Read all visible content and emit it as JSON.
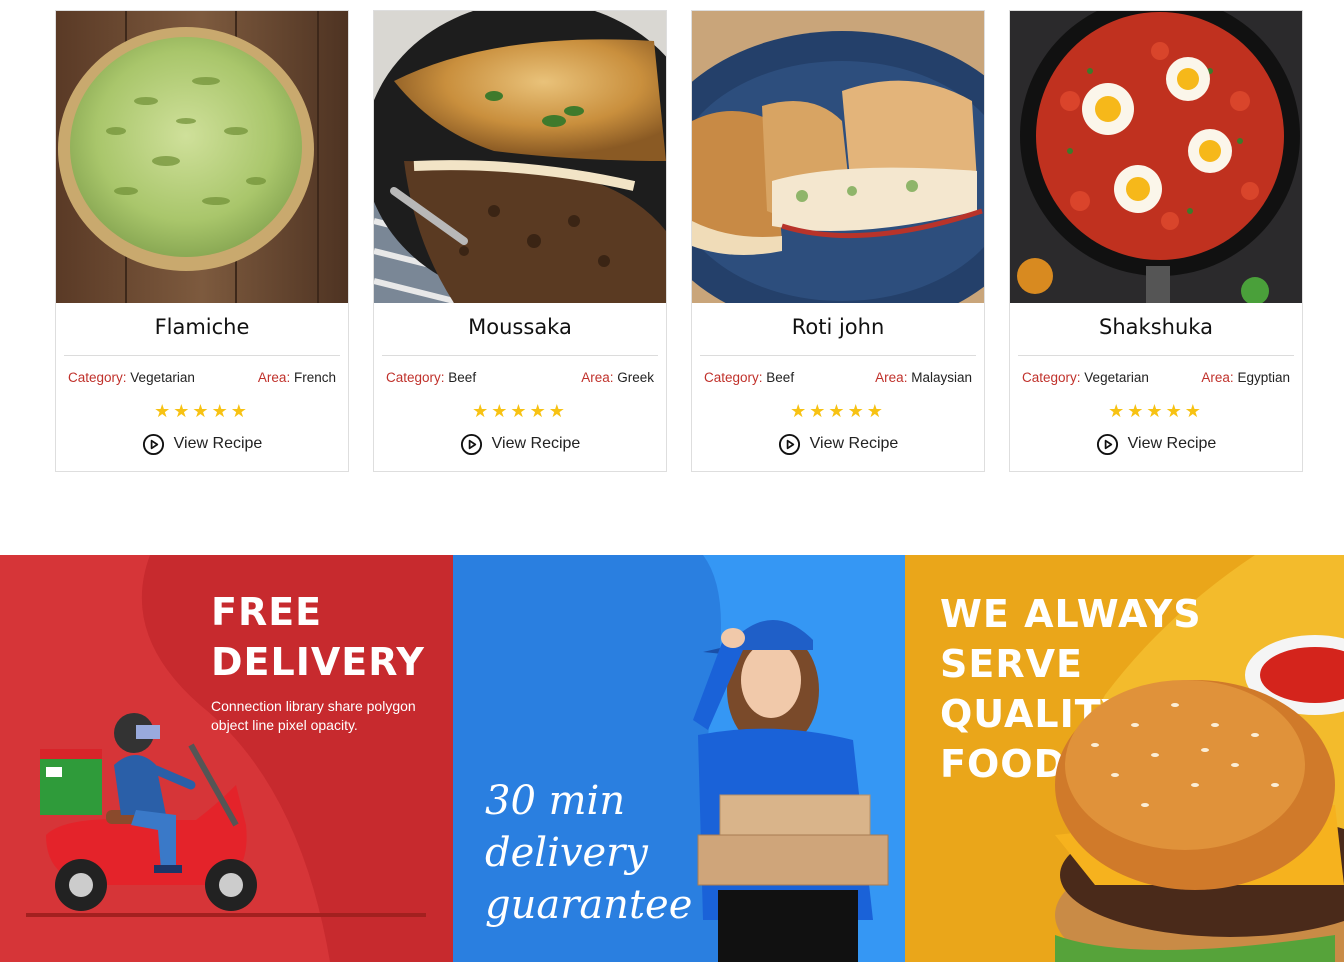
{
  "cards": [
    {
      "title": "Flamiche",
      "category_label": "Category:",
      "category": "Vegetarian",
      "area_label": "Area:",
      "area": "French",
      "rating": 5,
      "stars": "★★★★★",
      "cta": "View Recipe",
      "photo": "flamiche-tart-photo"
    },
    {
      "title": "Moussaka",
      "category_label": "Category:",
      "category": "Beef",
      "area_label": "Area:",
      "area": "Greek",
      "rating": 5,
      "stars": "★★★★★",
      "cta": "View Recipe",
      "photo": "moussaka-skillet-photo"
    },
    {
      "title": "Roti john",
      "category_label": "Category:",
      "category": "Beef",
      "area_label": "Area:",
      "area": "Malaysian",
      "rating": 5,
      "stars": "★★★★★",
      "cta": "View Recipe",
      "photo": "roti-john-sandwich-photo"
    },
    {
      "title": "Shakshuka",
      "category_label": "Category:",
      "category": "Vegetarian",
      "area_label": "Area:",
      "area": "Egyptian",
      "rating": 5,
      "stars": "★★★★★",
      "cta": "View Recipe",
      "photo": "shakshuka-pan-photo"
    }
  ],
  "banners": {
    "delivery": {
      "heading_line1": "FREE",
      "heading_line2": "DELIVERY",
      "subtext": "Connection library share polygon object line pixel opacity.",
      "bg_color": "#d23034",
      "illustration": "scooter-rider-illustration"
    },
    "guarantee": {
      "line1": "30 min",
      "line2": "delivery",
      "line3": "guarantee",
      "bg_color": "#2e8ff0",
      "photo": "delivery-woman-photo"
    },
    "quality": {
      "line1": "WE ALWAYS",
      "line2": "SERVE",
      "line3": "QUALITY",
      "line4": "FOOD",
      "bg_color": "#f0b323",
      "photo": "burger-photo"
    }
  },
  "colors": {
    "label_red": "#c0312b",
    "star_yellow": "#f7c213",
    "card_border": "#dedede"
  },
  "icons": {
    "play": "play-circle-icon",
    "star": "star-icon"
  }
}
